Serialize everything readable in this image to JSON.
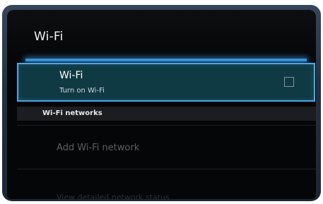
{
  "header": {
    "title": "Wi-Fi"
  },
  "wifi_toggle": {
    "title": "Wi-Fi",
    "summary": "Turn on Wi-Fi",
    "checked": false
  },
  "networks_section": {
    "header": "Wi-Fi networks",
    "add_network_label": "Add Wi-Fi network",
    "partial_item_label": "View detailed network status"
  },
  "colors": {
    "accent": "#3a8fd8",
    "selection_background": "#0f3a44",
    "frame": "#233143"
  }
}
